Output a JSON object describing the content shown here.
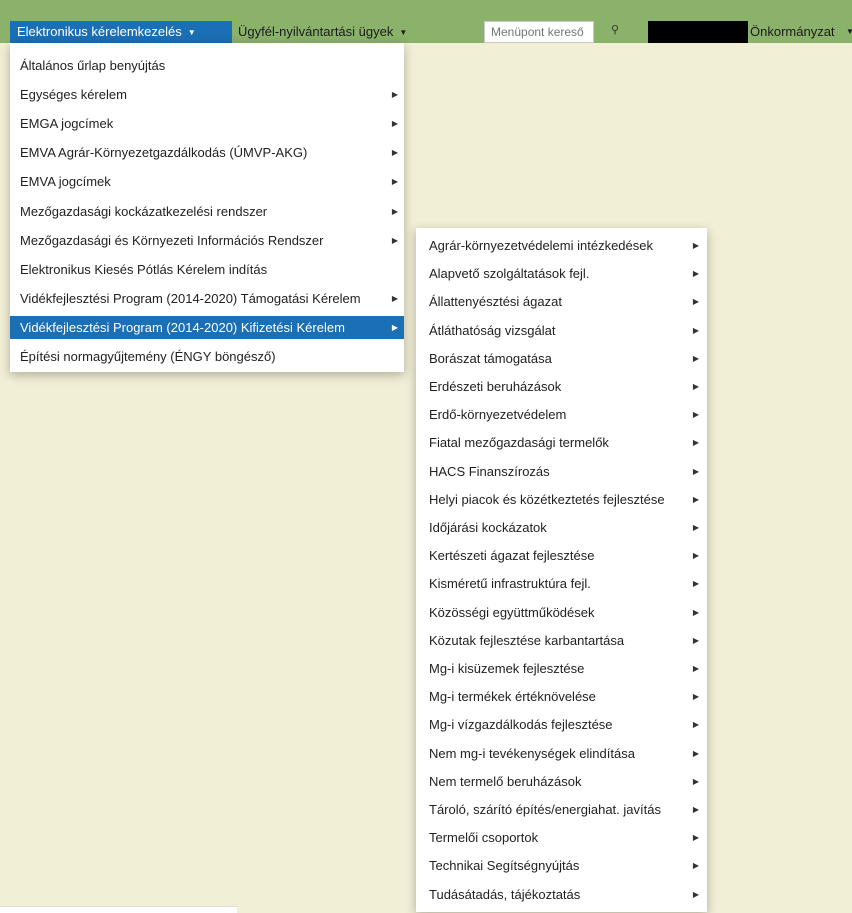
{
  "nav": {
    "active_menu": "Elektronikus kérelemkezelés",
    "client_menu": "Ügyfél-nyilvántartási ügyek",
    "search_placeholder": "Menüpont kereső",
    "org_label": "Önkormányzat",
    "caret_icon": "caret-down",
    "user_icon": "user-icon"
  },
  "colors": {
    "navbar": "#8bb26a",
    "highlight": "#1a6fb5",
    "background": "#f1efd5"
  },
  "menu1": {
    "items": [
      {
        "label": "Általános űrlap benyújtás",
        "has_submenu": false
      },
      {
        "label": "Egységes kérelem",
        "has_submenu": true
      },
      {
        "label": "EMGA jogcímek",
        "has_submenu": true
      },
      {
        "label": "EMVA Agrár-Környezetgazdálkodás (ÚMVP-AKG)",
        "has_submenu": true
      },
      {
        "label": "EMVA jogcímek",
        "has_submenu": true
      },
      {
        "label": "Mezőgazdasági kockázatkezelési rendszer",
        "has_submenu": true
      },
      {
        "label": "Mezőgazdasági és Környezeti Információs Rendszer",
        "has_submenu": true
      },
      {
        "label": "Elektronikus Kiesés Pótlás Kérelem indítás",
        "has_submenu": false
      },
      {
        "label": "Vidékfejlesztési Program (2014-2020) Támogatási Kérelem",
        "has_submenu": true
      },
      {
        "label": "Vidékfejlesztési Program (2014-2020) Kifizetési Kérelem",
        "has_submenu": true,
        "highlighted": true
      },
      {
        "label": "Építési normagyűjtemény (ÉNGY böngésző)",
        "has_submenu": false
      }
    ]
  },
  "menu2": {
    "items": [
      {
        "label": "Agrár-környezetvédelemi intézkedések"
      },
      {
        "label": "Alapvető szolgáltatások fejl."
      },
      {
        "label": "Állattenyésztési ágazat"
      },
      {
        "label": "Átláthatóság vizsgálat"
      },
      {
        "label": "Borászat támogatása"
      },
      {
        "label": "Erdészeti beruházások"
      },
      {
        "label": "Erdő-környezetvédelem"
      },
      {
        "label": "Fiatal mezőgazdasági termelők"
      },
      {
        "label": "HACS Finanszírozás"
      },
      {
        "label": "Helyi piacok és közétkeztetés fejlesztése"
      },
      {
        "label": "Időjárási kockázatok"
      },
      {
        "label": "Kertészeti ágazat fejlesztése"
      },
      {
        "label": "Kisméretű infrastruktúra fejl."
      },
      {
        "label": "Közösségi együttműködések"
      },
      {
        "label": "Közutak fejlesztése karbantartása"
      },
      {
        "label": "Mg-i kisüzemek fejlesztése"
      },
      {
        "label": "Mg-i termékek értéknövelése"
      },
      {
        "label": "Mg-i vízgazdálkodás fejlesztése"
      },
      {
        "label": "Nem mg-i tevékenységek elindítása"
      },
      {
        "label": "Nem termelő beruházások"
      },
      {
        "label": "Tároló, szárító építés/energiahat. javítás"
      },
      {
        "label": "Termelői csoportok"
      },
      {
        "label": "Technikai Segítségnyújtás"
      },
      {
        "label": "Tudásátadás, tájékoztatás"
      }
    ]
  }
}
